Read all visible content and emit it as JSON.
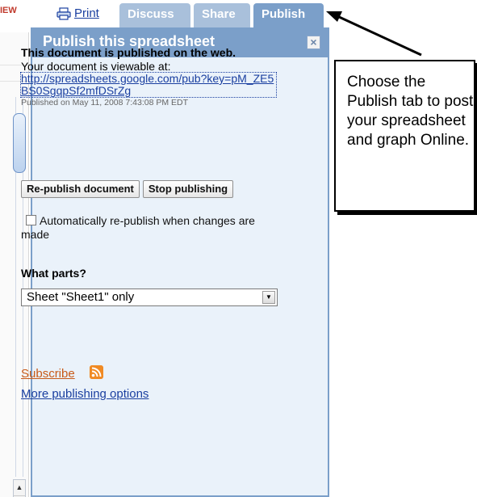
{
  "fragment": {
    "left_text": "IEW"
  },
  "toolbar": {
    "print_label": "Print",
    "tabs": [
      {
        "label": "Discuss"
      },
      {
        "label": "Share"
      },
      {
        "label": "Publish"
      }
    ]
  },
  "panel": {
    "title": "Publish this spreadsheet",
    "close_label": "×",
    "status": "This document is published on the web.",
    "viewable_label": "Your document is viewable at:",
    "url": "http://spreadsheets.google.com/pub?key=pM_ZE5BS0SgqpSf2mfDSrZg",
    "published_on": "Published on May 11, 2008 7:43:08 PM EDT",
    "republish_label": "Re-publish document",
    "stop_label": "Stop publishing",
    "auto_republish_label": "Automatically re-publish when changes are made",
    "auto_republish_checked": false,
    "parts_label": "What parts?",
    "parts_selected": "Sheet \"Sheet1\" only",
    "subscribe_label": "Subscribe",
    "more_options_label": "More publishing options"
  },
  "callout": {
    "text": "Choose the Publish tab to post your spreadsheet and graph Online."
  },
  "colors": {
    "tab_active": "#7b9fc9",
    "tab_inactive": "#a9c0db",
    "panel_bg": "#eaf2fa",
    "link": "#1a3fa0",
    "subscribe": "#c85a18",
    "rss": "#f08a24"
  },
  "icons": [
    "printer-icon",
    "close-icon",
    "checkbox",
    "dropdown-arrow-icon",
    "rss-icon",
    "scroll-up-icon",
    "scroll-down-icon",
    "callout-arrow"
  ]
}
